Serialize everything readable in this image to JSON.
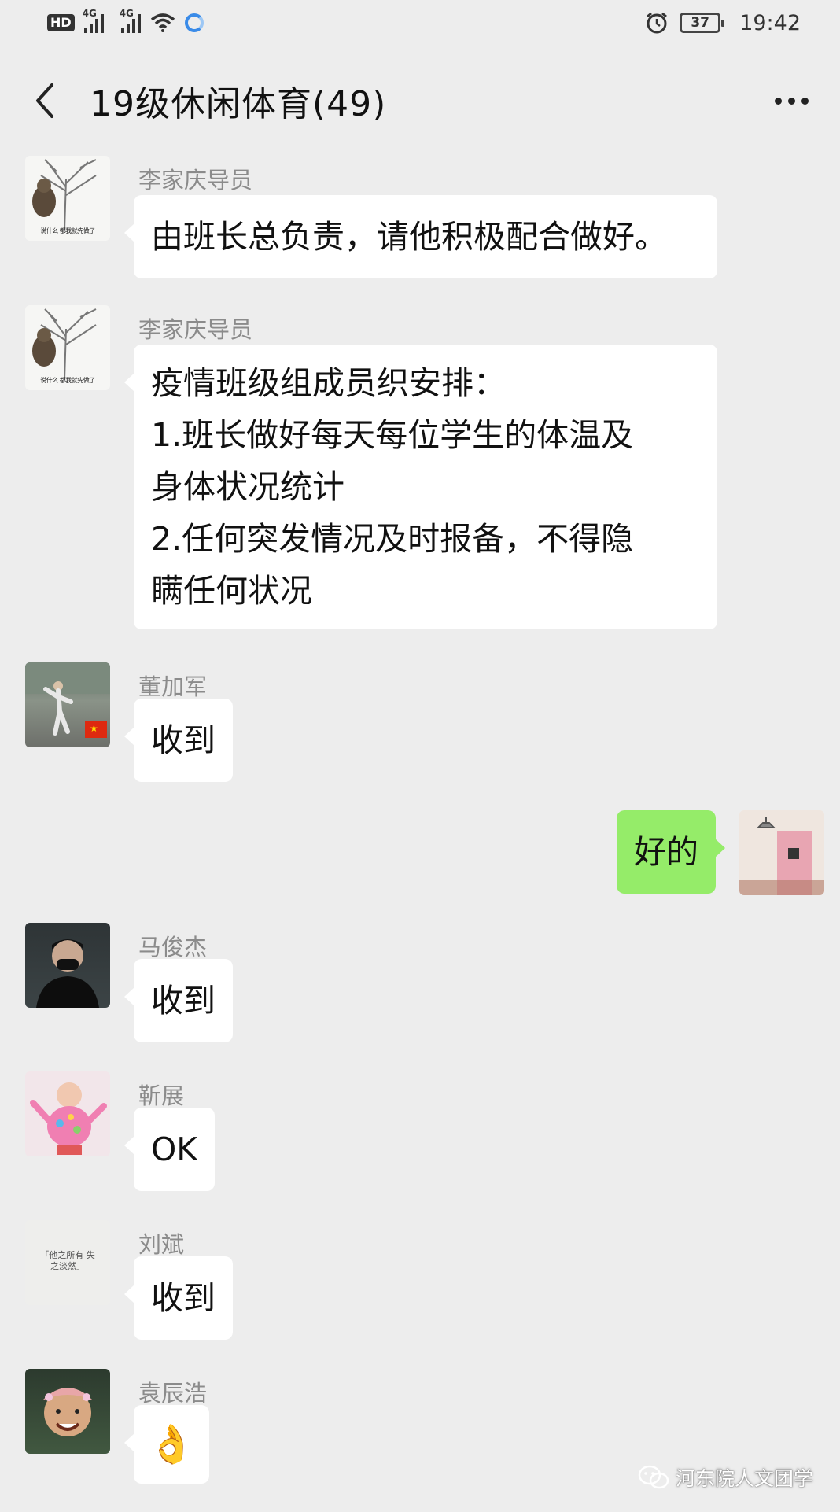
{
  "status_bar": {
    "hd_label": "HD",
    "sim1_label": "4G",
    "sim2_label": "4G",
    "battery_level": "37",
    "time": "19:42"
  },
  "header": {
    "title": "19级休闲体育(49)"
  },
  "messages": [
    {
      "sender": "李家庆导员",
      "text": "由班长总负责，请他积极配合做好。"
    },
    {
      "sender": "李家庆导员",
      "lines": [
        "疫情班级组成员织安排：",
        "1.班长做好每天每位学生的体温及",
        "身体状况统计",
        "2.任何突发情况及时报备，不得隐",
        "瞒任何状况"
      ]
    },
    {
      "sender": "董加军",
      "text": "收到"
    },
    {
      "sender": "",
      "text": "好的",
      "mine": true
    },
    {
      "sender": "马俊杰",
      "text": "收到"
    },
    {
      "sender": "靳展",
      "text": "OK"
    },
    {
      "sender": "刘斌",
      "text": "收到"
    },
    {
      "sender": "袁辰浩",
      "emoji": "👌"
    }
  ],
  "avatars": {
    "tree_caption": "说什么 都我就先做了",
    "text_avatar_caption": "「他之所有 失之淡然」"
  },
  "watermark": {
    "text": "河东院人文团学"
  },
  "colors": {
    "background": "#ededed",
    "own_bubble": "#95ec69",
    "other_bubble": "#ffffff",
    "sender_name": "#8b8b8b"
  }
}
